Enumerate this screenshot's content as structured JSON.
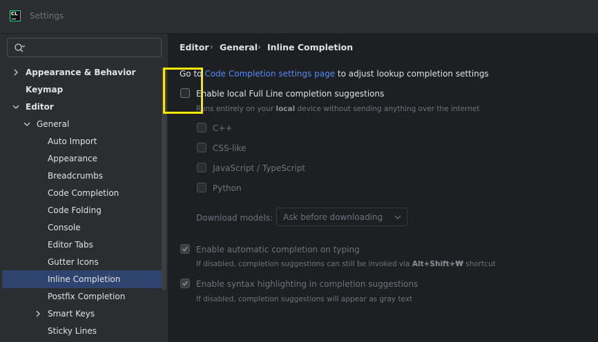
{
  "window": {
    "title": "Settings"
  },
  "search": {
    "placeholder": "",
    "value": ""
  },
  "sidebar": {
    "items": [
      {
        "label": "Appearance & Behavior",
        "expanded": false
      },
      {
        "label": "Keymap"
      },
      {
        "label": "Editor",
        "expanded": true
      },
      {
        "label": "General",
        "expanded": true
      },
      {
        "label": "Auto Import"
      },
      {
        "label": "Appearance"
      },
      {
        "label": "Breadcrumbs"
      },
      {
        "label": "Code Completion"
      },
      {
        "label": "Code Folding"
      },
      {
        "label": "Console"
      },
      {
        "label": "Editor Tabs"
      },
      {
        "label": "Gutter Icons"
      },
      {
        "label": "Inline Completion",
        "selected": true
      },
      {
        "label": "Postfix Completion"
      },
      {
        "label": "Smart Keys",
        "expanded": false
      },
      {
        "label": "Sticky Lines"
      }
    ]
  },
  "breadcrumb": {
    "items": [
      "Editor",
      "General",
      "Inline Completion"
    ]
  },
  "main": {
    "goto_prefix": "Go to",
    "goto_link": "Code Completion settings page",
    "goto_suffix": "to adjust lookup completion settings",
    "full_line": {
      "label": "Enable local Full Line completion suggestions",
      "checked": false,
      "hint_prefix": "Runs entirely on your",
      "hint_bold": "local",
      "hint_suffix": "device without sending anything over the internet"
    },
    "languages": [
      {
        "label": "C++",
        "checked": false
      },
      {
        "label": "CSS-like",
        "checked": false
      },
      {
        "label": "JavaScript / TypeScript",
        "checked": false
      },
      {
        "label": "Python",
        "checked": false
      }
    ],
    "download_models": {
      "label": "Download models:",
      "value": "Ask before downloading"
    },
    "auto_completion": {
      "label": "Enable automatic completion on typing",
      "checked": true,
      "hint_prefix": "If disabled, completion suggestions can still be invoked via",
      "hint_shortcut": "Alt+Shift+₩",
      "hint_suffix": "shortcut"
    },
    "syntax_highlighting": {
      "label": "Enable syntax highlighting in completion suggestions",
      "checked": true,
      "hint": "If disabled, completion suggestions will appear as gray text"
    }
  },
  "colors": {
    "background": "#1e1f22",
    "panel": "#2b2d30",
    "selection": "#2e436e",
    "link": "#548af7",
    "highlight_box": "#f5e90a"
  }
}
